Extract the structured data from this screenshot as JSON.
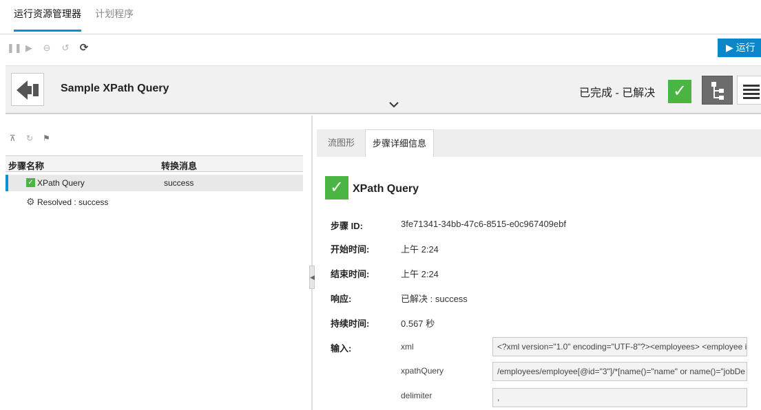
{
  "top_tabs": [
    {
      "label": "运行资源管理器"
    },
    {
      "label": "计划程序"
    }
  ],
  "toolbar": {
    "run_label": "运行",
    "icons": [
      "pause-icon",
      "step-forward-icon",
      "cancel-icon",
      "reassign-icon",
      "refresh-icon"
    ]
  },
  "header": {
    "title": "Sample XPath Query",
    "status": "已完成 - 已解决"
  },
  "left": {
    "columns": [
      "步骤名称",
      "转换消息"
    ],
    "rows": [
      {
        "name": "XPath Query",
        "message": "success",
        "selected": true,
        "icon": "success-check-icon"
      },
      {
        "name": "Resolved : success",
        "message": "",
        "selected": false,
        "icon": "gear-icon"
      }
    ]
  },
  "right": {
    "tabs": [
      {
        "label": "流图形"
      },
      {
        "label": "步骤详细信息"
      }
    ],
    "step_title": "XPath Query",
    "fields": [
      {
        "label": "步骤 ID:",
        "value": "3fe71341-34bb-47c6-8515-e0c967409ebf"
      },
      {
        "label": "开始时间:",
        "value": "上午 2:24"
      },
      {
        "label": "结束时间:",
        "value": "上午 2:24"
      },
      {
        "label": "响应:",
        "value": "已解决 : success"
      },
      {
        "label": "持续时间:",
        "value": "0.567 秒"
      }
    ],
    "inputs_label": "输入:",
    "inputs": [
      {
        "name": "xml",
        "value": "<?xml version=\"1.0\" encoding=\"UTF-8\"?><employees>  <employee i"
      },
      {
        "name": "xpathQuery",
        "value": "/employees/employee[@id=\"3\"]/*[name()=\"name\" or name()=\"jobDe"
      },
      {
        "name": "delimiter",
        "value": ","
      }
    ]
  },
  "colors": {
    "accent": "#0b90d3",
    "run_button": "#0b86c9",
    "success": "#4bb543"
  }
}
